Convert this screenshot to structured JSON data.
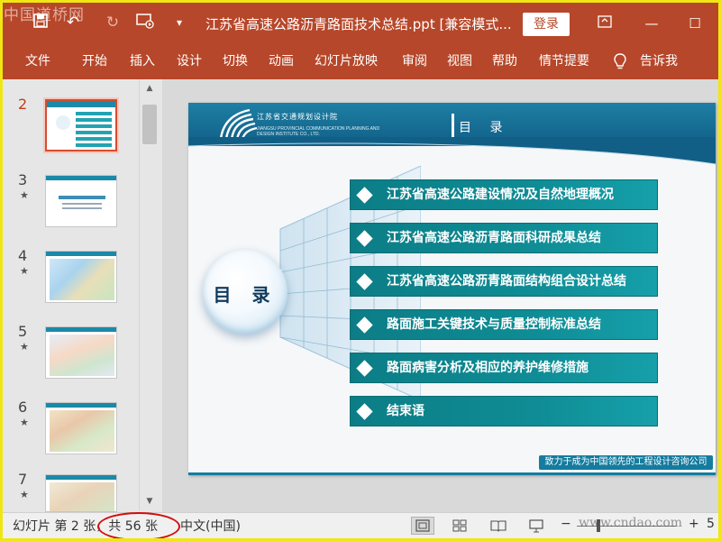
{
  "watermark_top": "中国道桥网",
  "watermark_bottom": "www.cndao.com",
  "titlebar": {
    "title": "江苏省高速公路沥青路面技术总结.ppt [兼容模式...",
    "login_label": "登录",
    "icons": [
      "save-icon",
      "undo-icon",
      "redo-icon",
      "present-from-start-icon",
      "customize-quick-access-icon",
      "ribbon-display-options-icon"
    ]
  },
  "menu": {
    "items": [
      "文件",
      "开始",
      "插入",
      "设计",
      "切换",
      "动画",
      "幻灯片放映",
      "审阅",
      "视图",
      "帮助",
      "情节提要"
    ],
    "tell_me_label": "告诉我"
  },
  "thumbnails": [
    {
      "number": "2",
      "star": "",
      "active": true,
      "kind": "toc"
    },
    {
      "number": "3",
      "star": "★",
      "active": false,
      "kind": "text"
    },
    {
      "number": "4",
      "star": "★",
      "active": false,
      "kind": "map"
    },
    {
      "number": "5",
      "star": "★",
      "active": false,
      "kind": "map"
    },
    {
      "number": "6",
      "star": "★",
      "active": false,
      "kind": "map"
    },
    {
      "number": "7",
      "star": "★",
      "active": false,
      "kind": "map"
    }
  ],
  "slide": {
    "org_name_cn": "江苏省交通规划设计院",
    "org_name_en1": "JIANGSU PROVINCIAL COMMUNICATION PLANNING AND",
    "org_name_en2": "DESIGN INSTITUTE CO., LTD.",
    "header_title": "目 录",
    "orb_text": "目 录",
    "toc_items": [
      "江苏省高速公路建设情况及自然地理概况",
      "江苏省高速公路沥青路面科研成果总结",
      "江苏省高速公路沥青路面结构组合设计总结",
      "路面施工关键技术与质量控制标准总结",
      "路面病害分析及相应的养护维修措施",
      "结束语"
    ],
    "footer": "致力于成为中国领先的工程设计咨询公司"
  },
  "statusbar": {
    "slide_info": "幻灯片 第 2 张，共 56 张",
    "language": "中文(中国)",
    "zoom_minus": "−",
    "zoom_plus": "+",
    "zoom_percent_fragment": "5"
  },
  "colors": {
    "ribbon": "#b7472a",
    "toc_teal": "#0f8c95",
    "header_blue": "#1e7fa4",
    "annotation_red": "#d20d0d"
  }
}
